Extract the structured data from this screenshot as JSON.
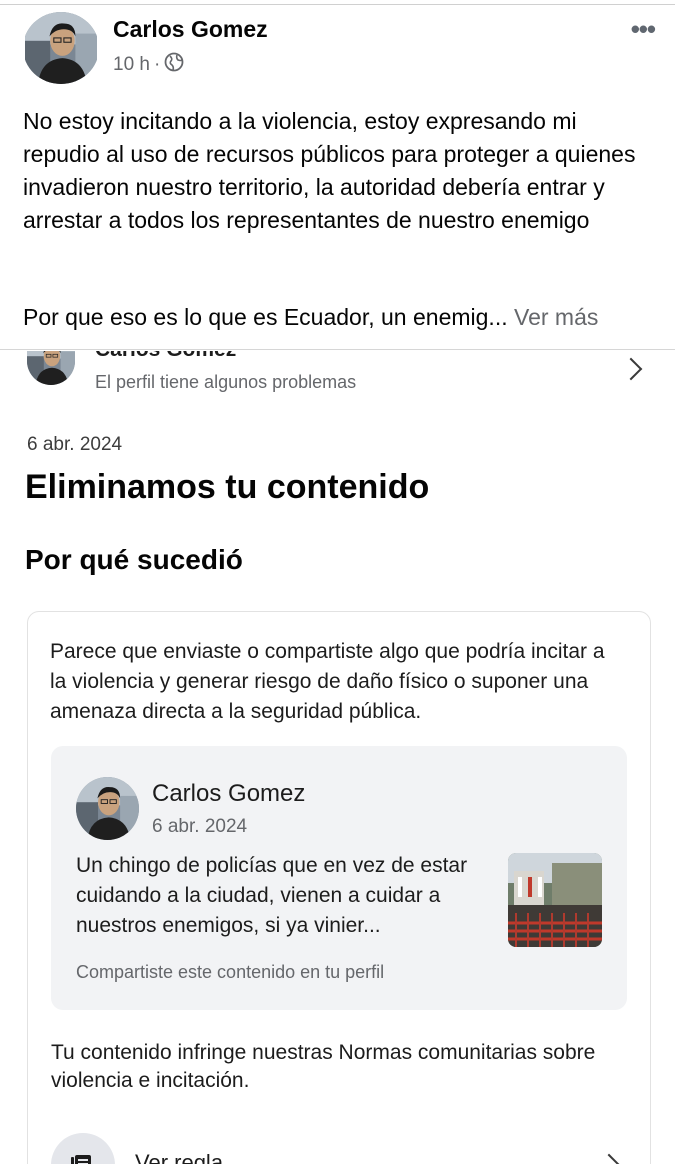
{
  "post": {
    "author": "Carlos Gomez",
    "time": "10 h",
    "separator": "·",
    "privacy_icon": "globe-icon",
    "more_label": "•••",
    "text_paragraph_1": "No estoy incitando a la violencia, estoy expresando mi repudio al uso de recursos públicos para proteger a quienes invadieron nuestro territorio, la autoridad debería entrar y arrestar a todos los representantes de nuestro enemigo",
    "text_paragraph_2": "Por que eso es lo que es Ecuador, un enemig...",
    "see_more": "Ver más"
  },
  "profile_row": {
    "name": "Carlos Gomez",
    "status": "El perfil tiene algunos problemas"
  },
  "notice": {
    "date": "6 abr. 2024",
    "title": "Eliminamos tu contenido",
    "section_title": "Por qué sucedió",
    "description": "Parece que enviaste o compartiste algo que podría incitar a la violencia y generar riesgo de daño físico o suponer una amenaza directa a la seguridad pública.",
    "shared_post": {
      "author": "Carlos Gomez",
      "date": "6 abr. 2024",
      "text": "Un chingo de policías que en vez de estar cuidando a la ciudad, vienen a cuidar a nuestros enemigos, si ya vinier...",
      "footer": "Compartiste este contenido en tu perfil"
    },
    "violation": "Tu contenido infringe nuestras Normas comunitarias sobre violencia e incitación.",
    "rule_label": "Ver regla"
  },
  "colors": {
    "text_primary": "#050505",
    "text_secondary": "#65676b",
    "inner_card_bg": "#f2f3f5"
  }
}
